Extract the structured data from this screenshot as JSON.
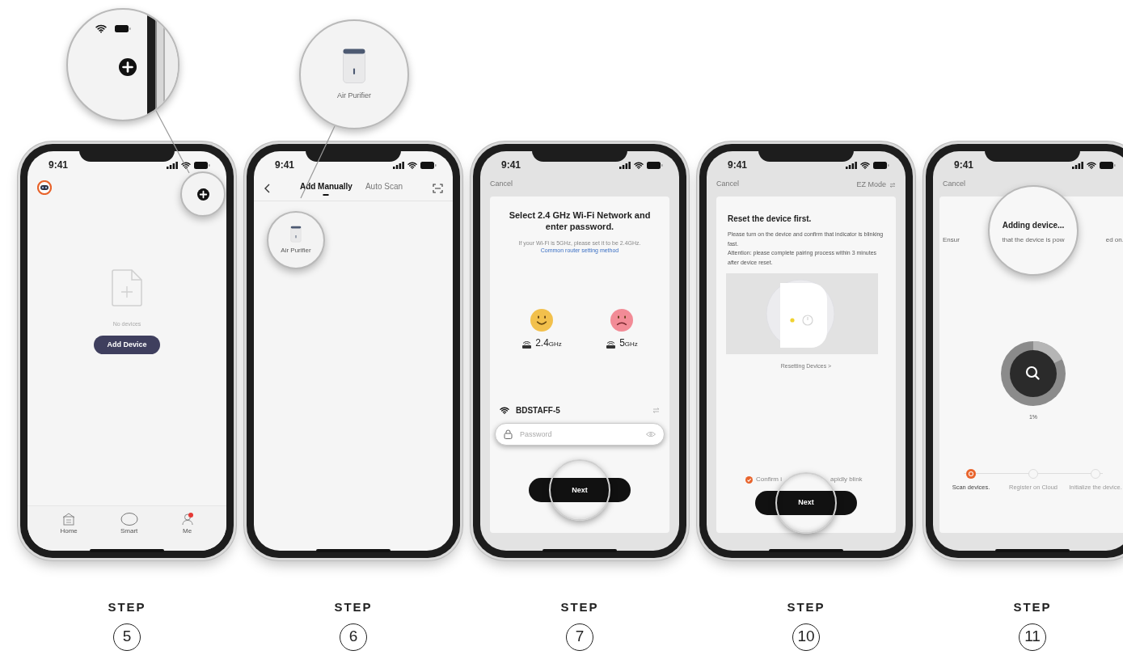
{
  "phones": [
    {
      "kind": "home",
      "status": {
        "time": "9:41"
      },
      "empty_text": "No devices",
      "add_button": "Add Device",
      "tabs": [
        {
          "label": "Home",
          "badge": false
        },
        {
          "label": "Smart",
          "badge": false
        },
        {
          "label": "Me",
          "badge": true
        }
      ],
      "step": {
        "label": "STEP",
        "number": "5"
      }
    },
    {
      "kind": "add",
      "status": {
        "time": "9:41"
      },
      "tabs": [
        {
          "label": "Add Manually",
          "selected": true
        },
        {
          "label": "Auto Scan",
          "selected": false
        }
      ],
      "devices": [
        {
          "label": "Air Purifier"
        }
      ],
      "zoom_label": "Air Purifier",
      "step": {
        "label": "STEP",
        "number": "6"
      }
    },
    {
      "kind": "wifi",
      "status": {
        "time": "9:41"
      },
      "cancel": "Cancel",
      "title": "Select 2.4 GHz Wi-Fi Network and enter password.",
      "hint": "If your Wi-Fi is 5GHz, please set it to be 2.4GHz.",
      "hint_link": "Common router setting method",
      "bands": [
        {
          "kind": "happy",
          "value": "2.4",
          "unit": "GHz",
          "color": "#f2c04c"
        },
        {
          "kind": "sad",
          "value": "5",
          "unit": "GHz",
          "color": "#f28b96"
        }
      ],
      "network": "BDSTAFF-5",
      "password": {
        "placeholder": "Password"
      },
      "next_button": "Next",
      "step": {
        "label": "STEP",
        "number": "7"
      }
    },
    {
      "kind": "reset",
      "status": {
        "time": "9:41"
      },
      "cancel": "Cancel",
      "mode": "EZ Mode",
      "title": "Reset the device first.",
      "paragraphs": [
        "Please turn on the device and confirm that indicator is blinking fast.",
        "Attention: please complete pairing process within 3 minutes after device reset."
      ],
      "link": "Resetting Devices >",
      "confirm": {
        "checked": true,
        "parts": [
          "Confirm i",
          "apidly blink"
        ]
      },
      "next_button": "Next",
      "step": {
        "label": "STEP",
        "number": "10"
      }
    },
    {
      "kind": "adding",
      "status": {
        "time": "9:41"
      },
      "cancel": "Cancel",
      "title": "Adding device...",
      "subtitle_parts": [
        "Ensur",
        "that the device is pow",
        "ed on."
      ],
      "percent": "1%",
      "stages": [
        {
          "label": "Scan devices.",
          "active": true
        },
        {
          "label": "Register on Cloud",
          "active": false
        },
        {
          "label": "Initialize the device.",
          "active": false
        }
      ],
      "step": {
        "label": "STEP",
        "number": "11"
      }
    }
  ]
}
